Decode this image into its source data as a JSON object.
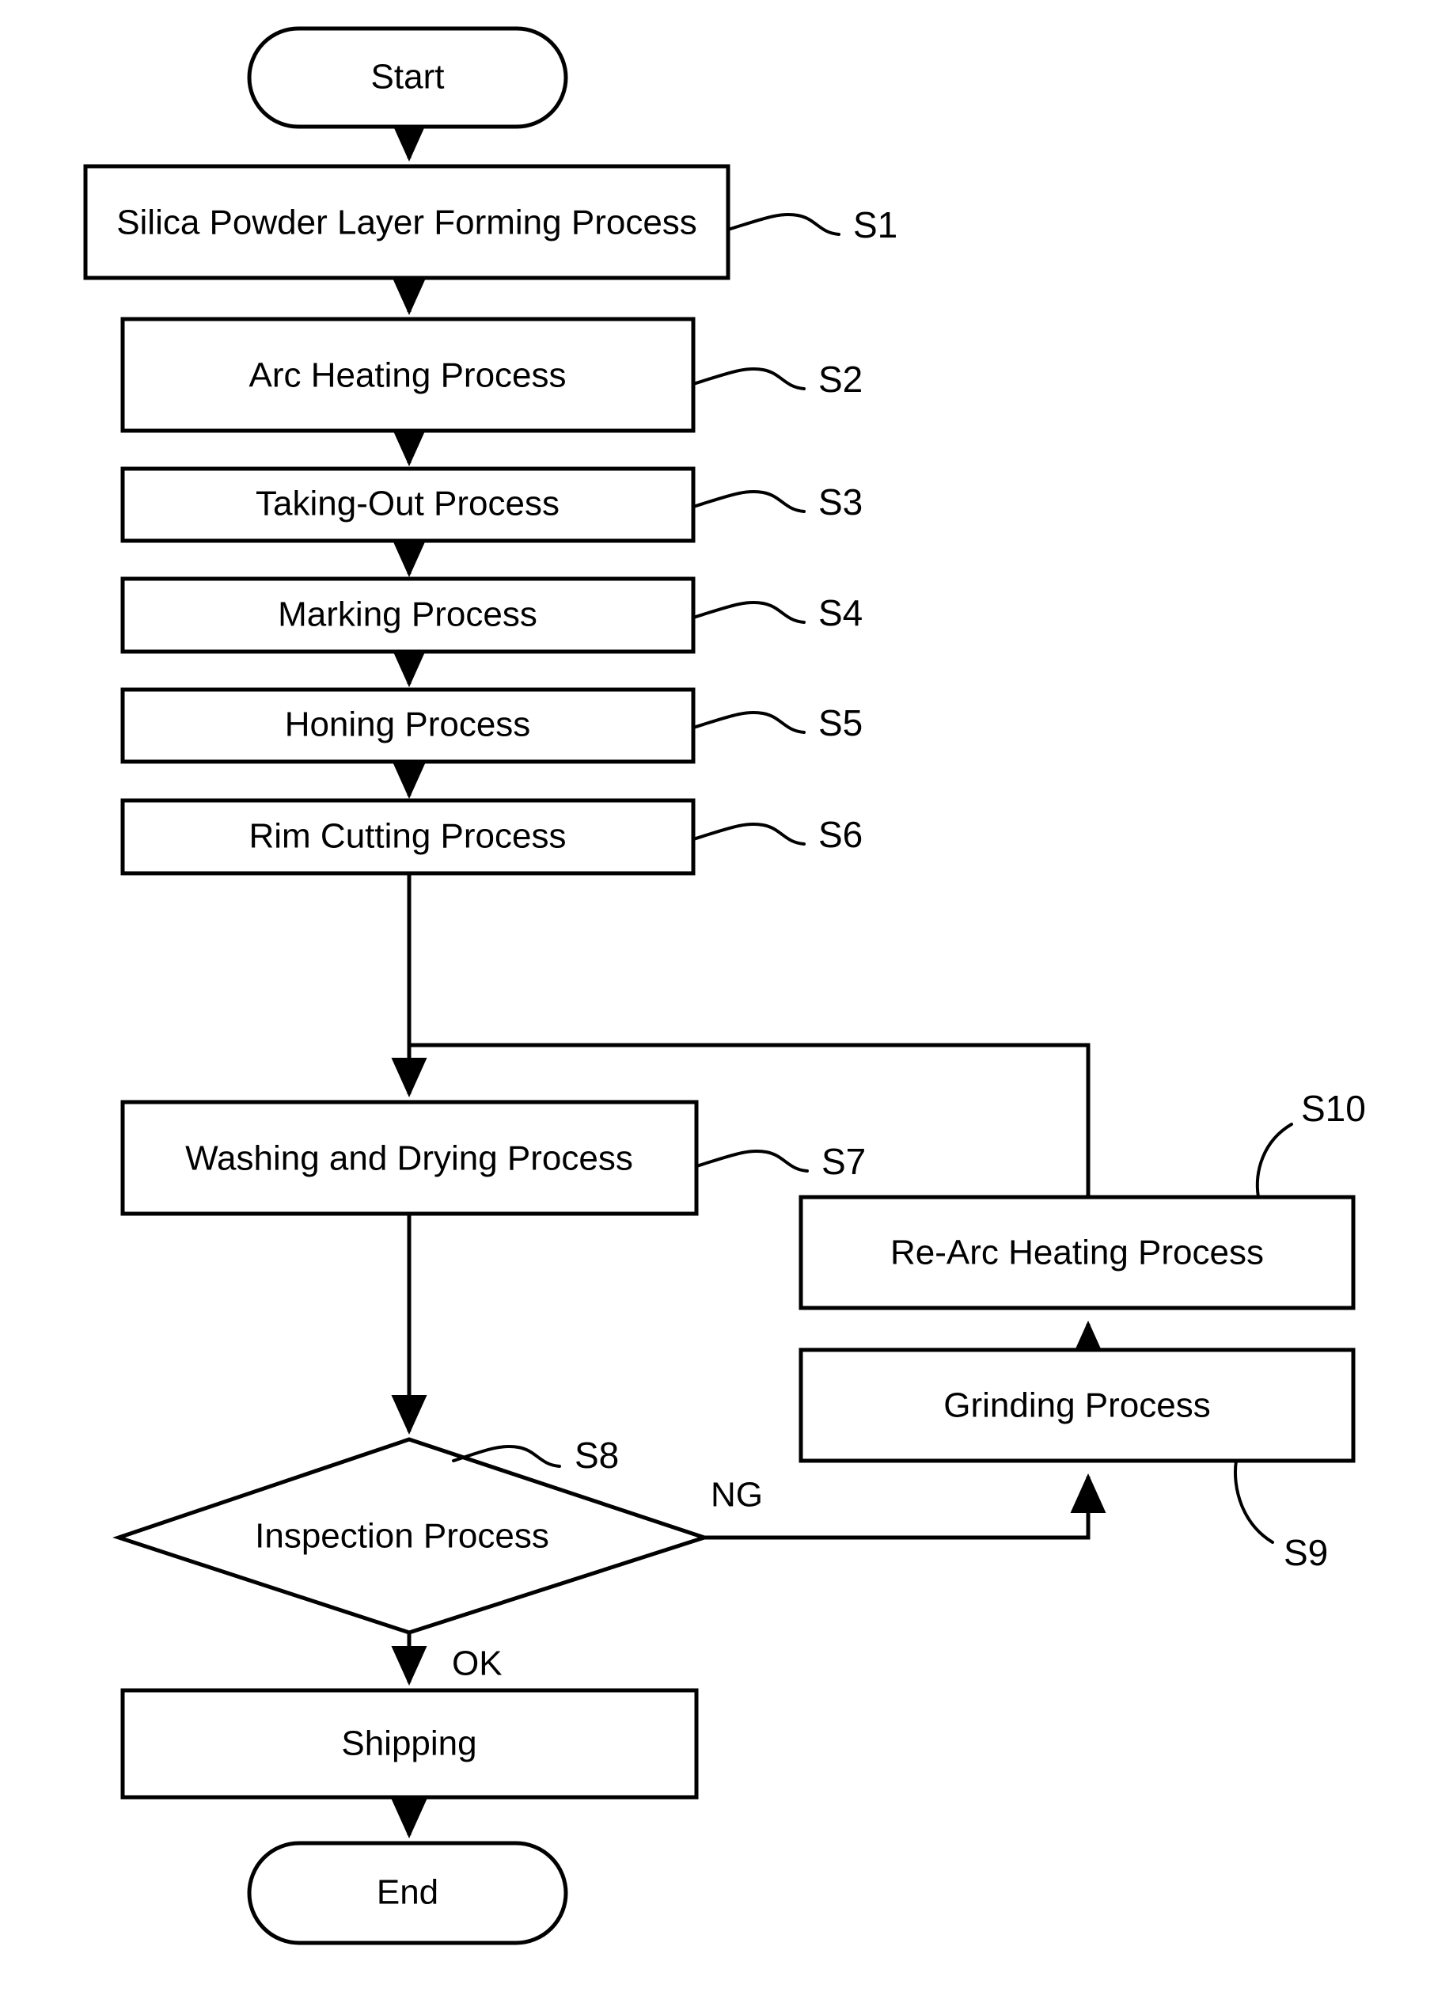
{
  "diagram": {
    "title": "Silica glass crucible manufacturing process flowchart",
    "type": "flowchart",
    "nodes": {
      "start": {
        "label": "Start",
        "shape": "terminator"
      },
      "s1": {
        "label": "Silica Powder Layer Forming Process",
        "ref": "S1",
        "shape": "process"
      },
      "s2": {
        "label": "Arc Heating Process",
        "ref": "S2",
        "shape": "process"
      },
      "s3": {
        "label": "Taking-Out Process",
        "ref": "S3",
        "shape": "process"
      },
      "s4": {
        "label": "Marking Process",
        "ref": "S4",
        "shape": "process"
      },
      "s5": {
        "label": "Honing Process",
        "ref": "S5",
        "shape": "process"
      },
      "s6": {
        "label": "Rim Cutting Process",
        "ref": "S6",
        "shape": "process"
      },
      "s7": {
        "label": "Washing and Drying Process",
        "ref": "S7",
        "shape": "process"
      },
      "s8": {
        "label": "Inspection Process",
        "ref": "S8",
        "shape": "decision"
      },
      "s9": {
        "label": "Grinding Process",
        "ref": "S9",
        "shape": "process"
      },
      "s10": {
        "label": "Re-Arc Heating Process",
        "ref": "S10",
        "shape": "process"
      },
      "shipping": {
        "label": "Shipping",
        "shape": "process"
      },
      "end": {
        "label": "End",
        "shape": "terminator"
      }
    },
    "branches": {
      "ng": "NG",
      "ok": "OK"
    },
    "colors": {
      "stroke": "#000000",
      "fill": "#ffffff",
      "text": "#000000"
    }
  }
}
